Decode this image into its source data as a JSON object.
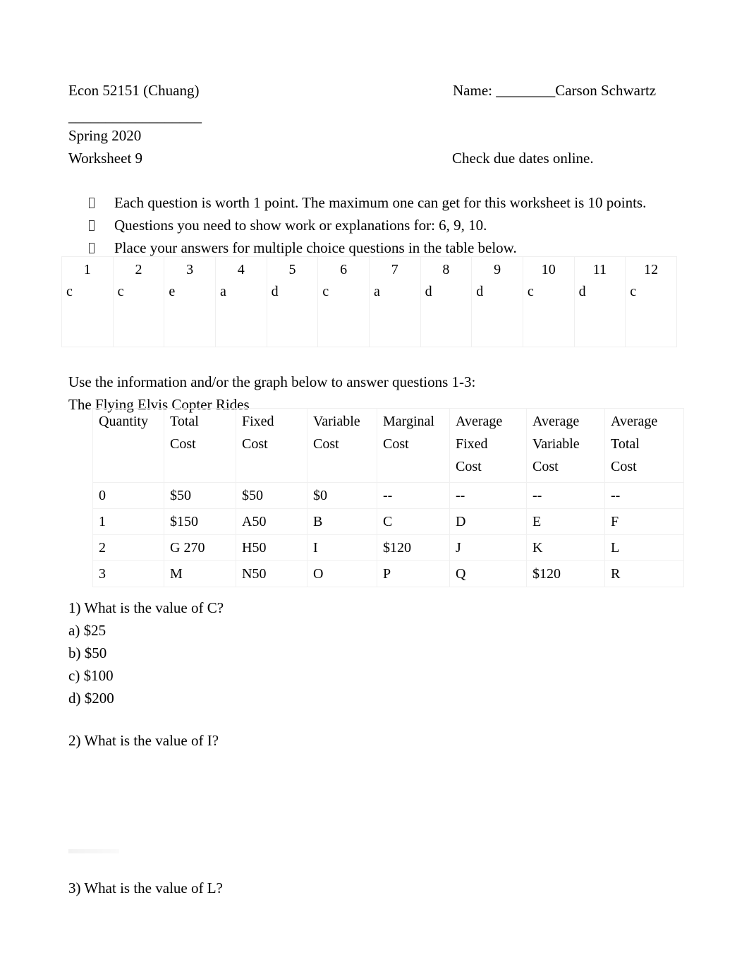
{
  "document": {
    "header": {
      "course": "Econ 52151 (Chuang)",
      "name_label": "Name: ________Carson Schwartz",
      "rule": "__________________",
      "term": "Spring 2020",
      "worksheet": "Worksheet 9",
      "due_note": "Check due dates online."
    },
    "instructions": [
      "Each question is worth 1 point. The maximum one can get for this worksheet is 10 points.",
      "Questions you need to show work or explanations for: 6, 9, 10.",
      "Place your answers for multiple choice questions in the table below."
    ],
    "answer_grid": {
      "numbers": [
        "1",
        "2",
        "3",
        "4",
        "5",
        "6",
        "7",
        "8",
        "9",
        "10",
        "11",
        "12"
      ],
      "answers": [
        "c",
        "c",
        "e",
        "a",
        "d",
        "c",
        "a",
        "d",
        "d",
        "c",
        "d",
        "c"
      ]
    },
    "prompt": {
      "use_info": "Use the information and/or the graph below to answer questions 1-3:",
      "table_title": "The Flying Elvis Copter Rides"
    },
    "cost_table": {
      "headers": [
        "Quantity",
        "Total\nCost",
        "Fixed\nCost",
        "Variable\nCost",
        "Marginal\nCost",
        "Average\nFixed\nCost",
        "Average\nVariable\nCost",
        "Average\nTotal\nCost"
      ],
      "rows": [
        [
          "0",
          "$50",
          "$50",
          "$0",
          "--",
          "--",
          "--",
          "--"
        ],
        [
          "1",
          "$150",
          "A50",
          "B",
          "C",
          "D",
          "E",
          "F"
        ],
        [
          "2",
          "G 270",
          "H50",
          "I",
          "$120",
          "J",
          "K",
          "L"
        ],
        [
          "3",
          "M",
          "N50",
          "O",
          "P",
          "Q",
          "$120",
          "R"
        ]
      ]
    },
    "questions": [
      {
        "stem": "1) What is the value of C?",
        "options": [
          "a) $25",
          "b) $50",
          "c) $100",
          "d) $200"
        ]
      },
      {
        "stem": "2) What is the value of I?",
        "options": []
      },
      {
        "stem": "3) What is the value of L?",
        "options": []
      }
    ]
  }
}
